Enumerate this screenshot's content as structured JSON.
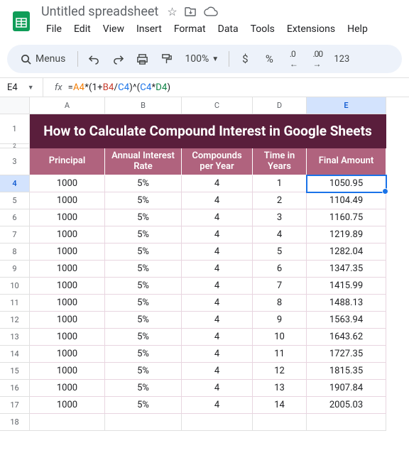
{
  "doc": {
    "title": "Untitled spreadsheet"
  },
  "menus": {
    "file": "File",
    "edit": "Edit",
    "view": "View",
    "insert": "Insert",
    "format": "Format",
    "data": "Data",
    "tools": "Tools",
    "extensions": "Extensions",
    "help": "Help"
  },
  "toolbar": {
    "menus_label": "Menus",
    "zoom": "100%",
    "currency": "$",
    "percent": "%",
    "decrease_dec": ".0",
    "increase_dec": ".00",
    "numfmt": "123"
  },
  "namebox": {
    "cell": "E4"
  },
  "formula": {
    "a": "A4",
    "b": "B4",
    "c": "C4",
    "c2": "C4",
    "d": "D4"
  },
  "cols": [
    "A",
    "B",
    "C",
    "D",
    "E"
  ],
  "rows": [
    "1",
    "2",
    "3",
    "4",
    "5",
    "6",
    "7",
    "8",
    "9",
    "10",
    "11",
    "12",
    "13",
    "14",
    "15",
    "16",
    "17",
    "18"
  ],
  "sheet": {
    "title": "How to Calculate Compound Interest in Google Sheets",
    "headers": {
      "principal": "Principal",
      "rate": "Annual Interest Rate",
      "compounds": "Compounds per Year",
      "time": "Time in Years",
      "final": "Final Amount"
    }
  },
  "chart_data": {
    "type": "table",
    "title": "How to Calculate Compound Interest in Google Sheets",
    "columns": [
      "Principal",
      "Annual Interest Rate",
      "Compounds per Year",
      "Time in Years",
      "Final Amount"
    ],
    "rows": [
      {
        "principal": 1000,
        "rate": "5%",
        "compounds": 4,
        "time": 1,
        "final": 1050.95
      },
      {
        "principal": 1000,
        "rate": "5%",
        "compounds": 4,
        "time": 2,
        "final": 1104.49
      },
      {
        "principal": 1000,
        "rate": "5%",
        "compounds": 4,
        "time": 3,
        "final": 1160.75
      },
      {
        "principal": 1000,
        "rate": "5%",
        "compounds": 4,
        "time": 4,
        "final": 1219.89
      },
      {
        "principal": 1000,
        "rate": "5%",
        "compounds": 4,
        "time": 5,
        "final": 1282.04
      },
      {
        "principal": 1000,
        "rate": "5%",
        "compounds": 4,
        "time": 6,
        "final": 1347.35
      },
      {
        "principal": 1000,
        "rate": "5%",
        "compounds": 4,
        "time": 7,
        "final": 1415.99
      },
      {
        "principal": 1000,
        "rate": "5%",
        "compounds": 4,
        "time": 8,
        "final": 1488.13
      },
      {
        "principal": 1000,
        "rate": "5%",
        "compounds": 4,
        "time": 9,
        "final": 1563.94
      },
      {
        "principal": 1000,
        "rate": "5%",
        "compounds": 4,
        "time": 10,
        "final": 1643.62
      },
      {
        "principal": 1000,
        "rate": "5%",
        "compounds": 4,
        "time": 11,
        "final": 1727.35
      },
      {
        "principal": 1000,
        "rate": "5%",
        "compounds": 4,
        "time": 12,
        "final": 1815.35
      },
      {
        "principal": 1000,
        "rate": "5%",
        "compounds": 4,
        "time": 13,
        "final": 1907.84
      },
      {
        "principal": 1000,
        "rate": "5%",
        "compounds": 4,
        "time": 14,
        "final": 2005.03
      }
    ]
  }
}
